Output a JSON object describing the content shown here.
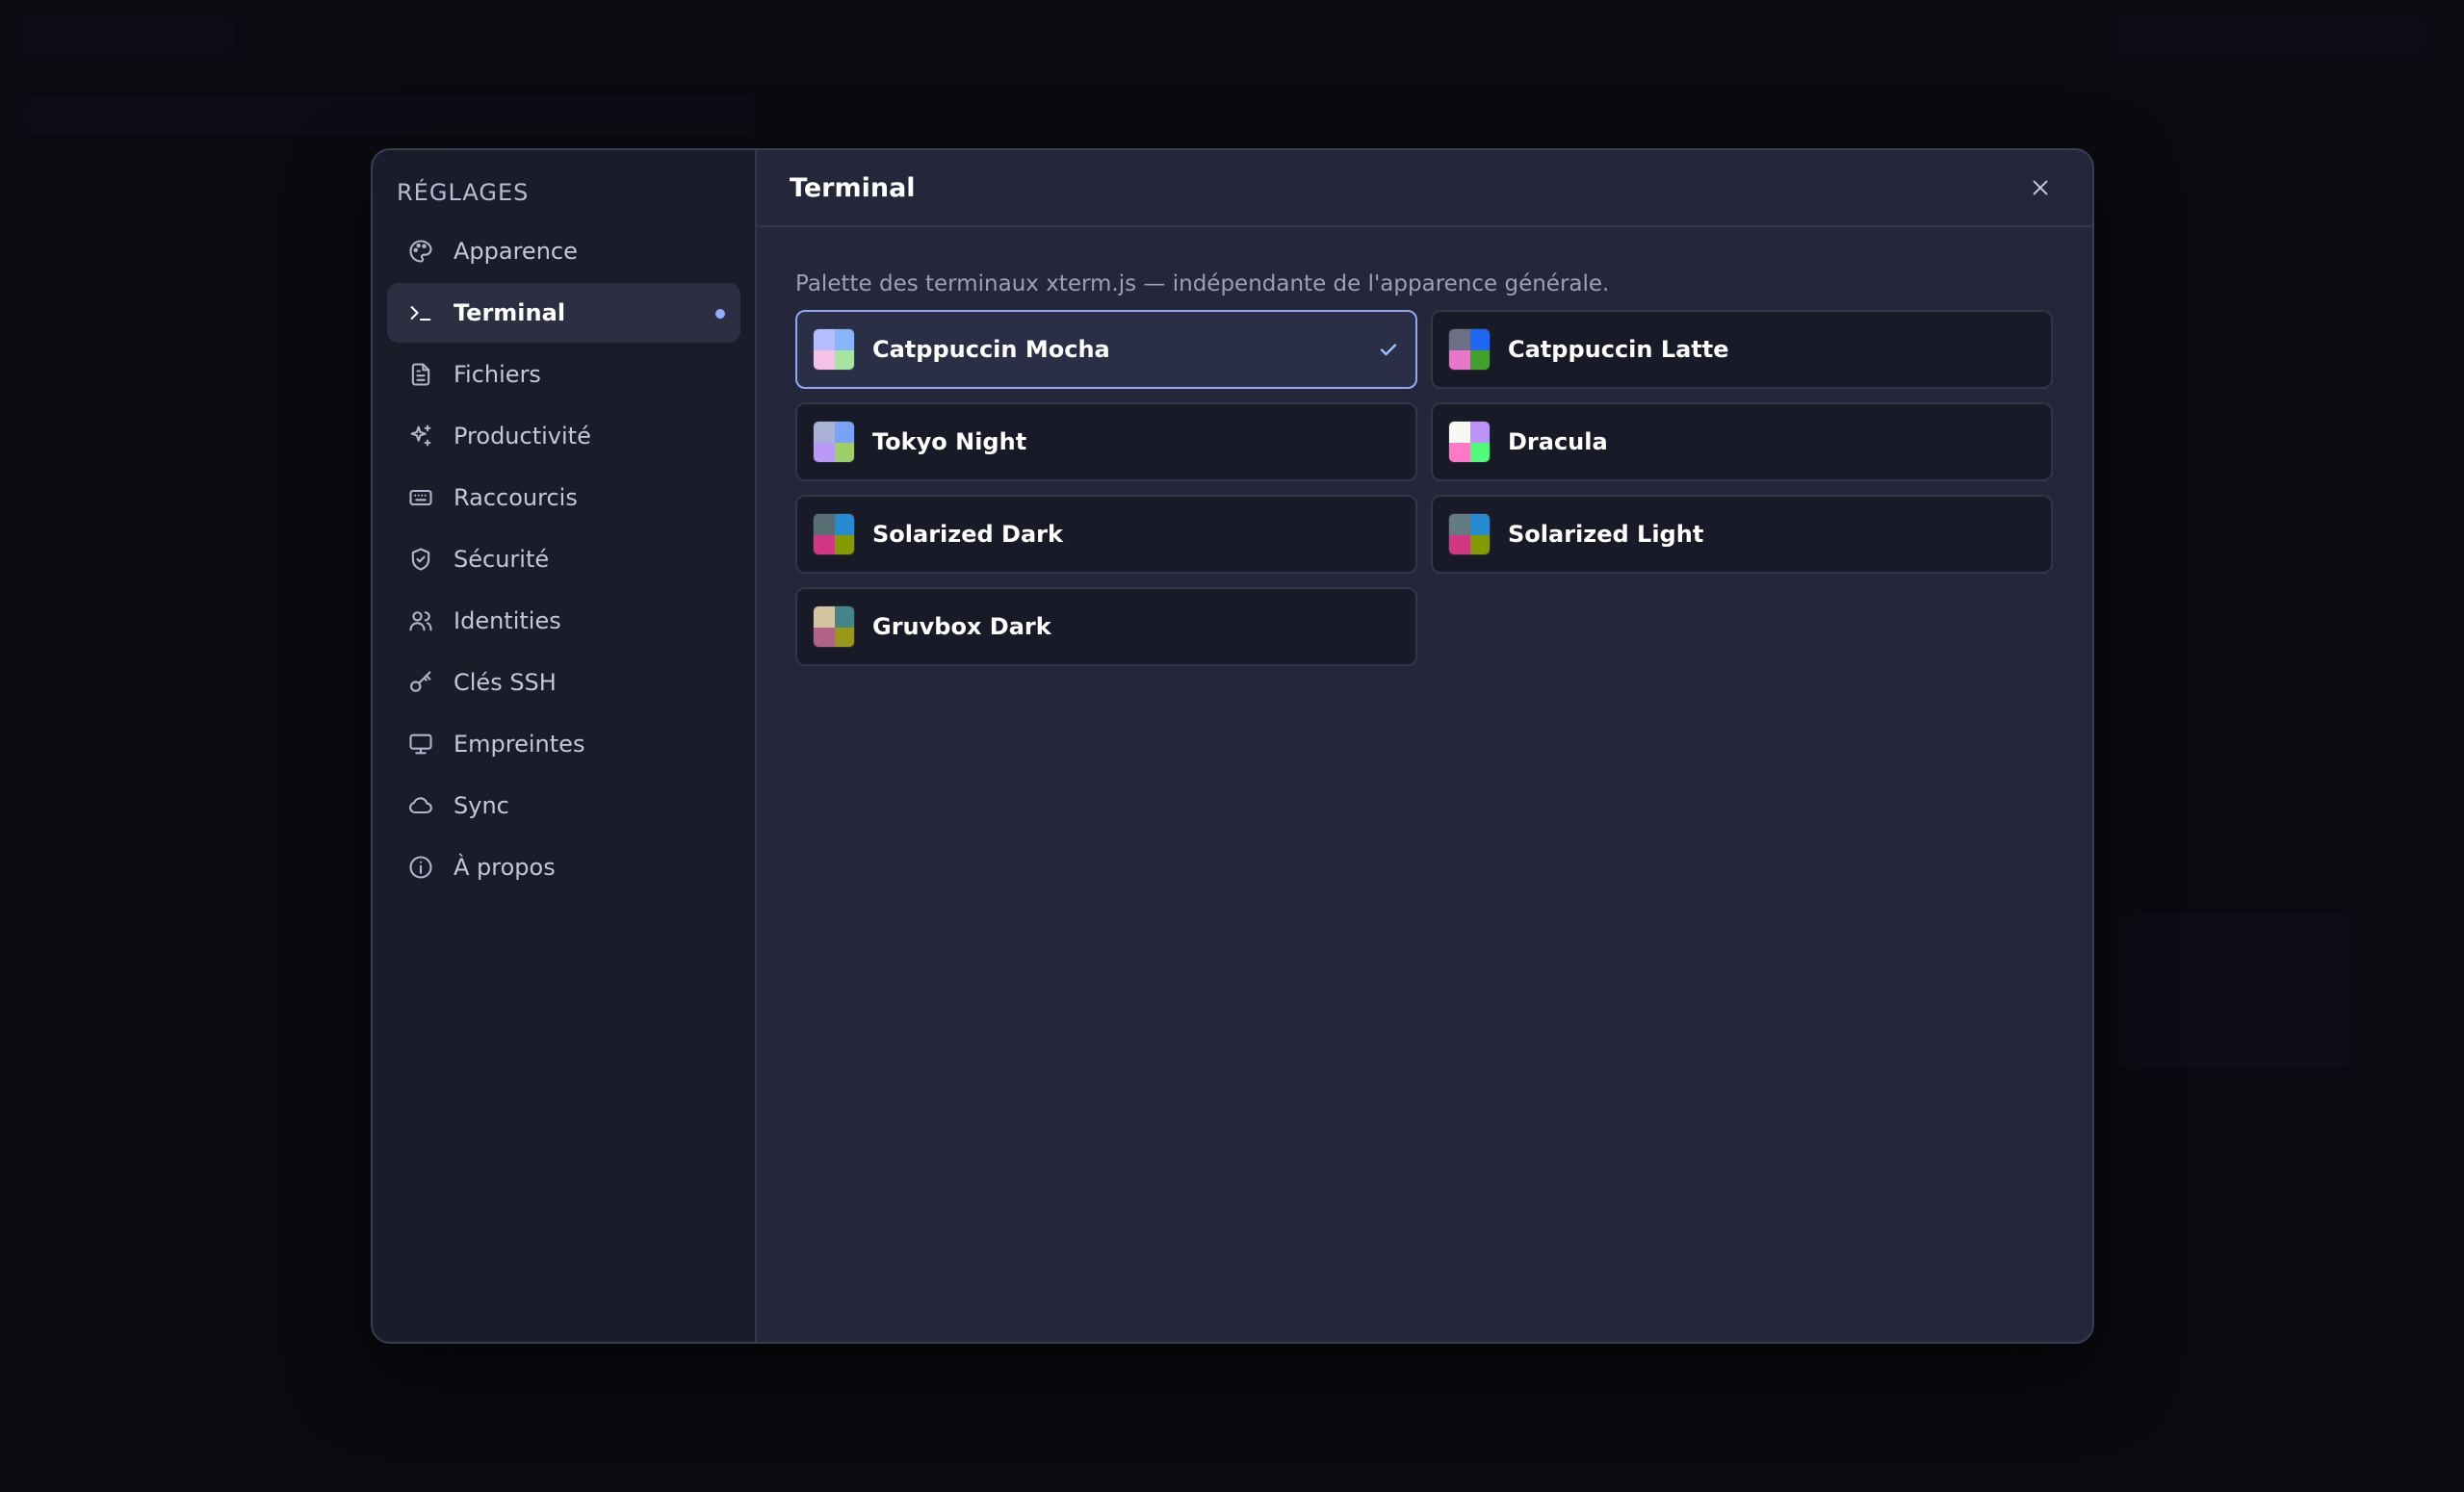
{
  "sidebar": {
    "title": "RÉGLAGES",
    "items": [
      {
        "label": "Apparence",
        "icon": "palette-icon"
      },
      {
        "label": "Terminal",
        "icon": "terminal-icon",
        "active": true
      },
      {
        "label": "Fichiers",
        "icon": "file-icon"
      },
      {
        "label": "Productivité",
        "icon": "sparkles-icon"
      },
      {
        "label": "Raccourcis",
        "icon": "keyboard-icon"
      },
      {
        "label": "Sécurité",
        "icon": "shield-icon"
      },
      {
        "label": "Identities",
        "icon": "users-icon"
      },
      {
        "label": "Clés SSH",
        "icon": "key-icon"
      },
      {
        "label": "Empreintes",
        "icon": "monitor-icon"
      },
      {
        "label": "Sync",
        "icon": "cloud-icon"
      },
      {
        "label": "À propos",
        "icon": "info-icon"
      }
    ]
  },
  "content": {
    "title": "Terminal",
    "description": "Palette des terminaux xterm.js — indépendante de l'apparence générale.",
    "themes": [
      {
        "name": "Catppuccin Mocha",
        "selected": true,
        "colors": [
          "#b4befe",
          "#89b4fa",
          "#f5c2e7",
          "#a6e3a1"
        ]
      },
      {
        "name": "Catppuccin Latte",
        "selected": false,
        "colors": [
          "#6c6f85",
          "#1e66f5",
          "#ea76cb",
          "#40a02b"
        ]
      },
      {
        "name": "Tokyo Night",
        "selected": false,
        "colors": [
          "#a9b1d6",
          "#7aa2f7",
          "#bb9af7",
          "#9ece6a"
        ]
      },
      {
        "name": "Dracula",
        "selected": false,
        "colors": [
          "#f8f8f2",
          "#bd93f9",
          "#ff79c6",
          "#50fa7b"
        ]
      },
      {
        "name": "Solarized Dark",
        "selected": false,
        "colors": [
          "#586e75",
          "#268bd2",
          "#d33682",
          "#859900"
        ]
      },
      {
        "name": "Solarized Light",
        "selected": false,
        "colors": [
          "#657b83",
          "#268bd2",
          "#d33682",
          "#859900"
        ]
      },
      {
        "name": "Gruvbox Dark",
        "selected": false,
        "colors": [
          "#d5c4a1",
          "#458588",
          "#b16286",
          "#98971a"
        ]
      }
    ]
  },
  "colors": {
    "accent": "#8fb0ff",
    "modal_bg": "#24273a",
    "sidebar_bg": "#1b1c29"
  }
}
